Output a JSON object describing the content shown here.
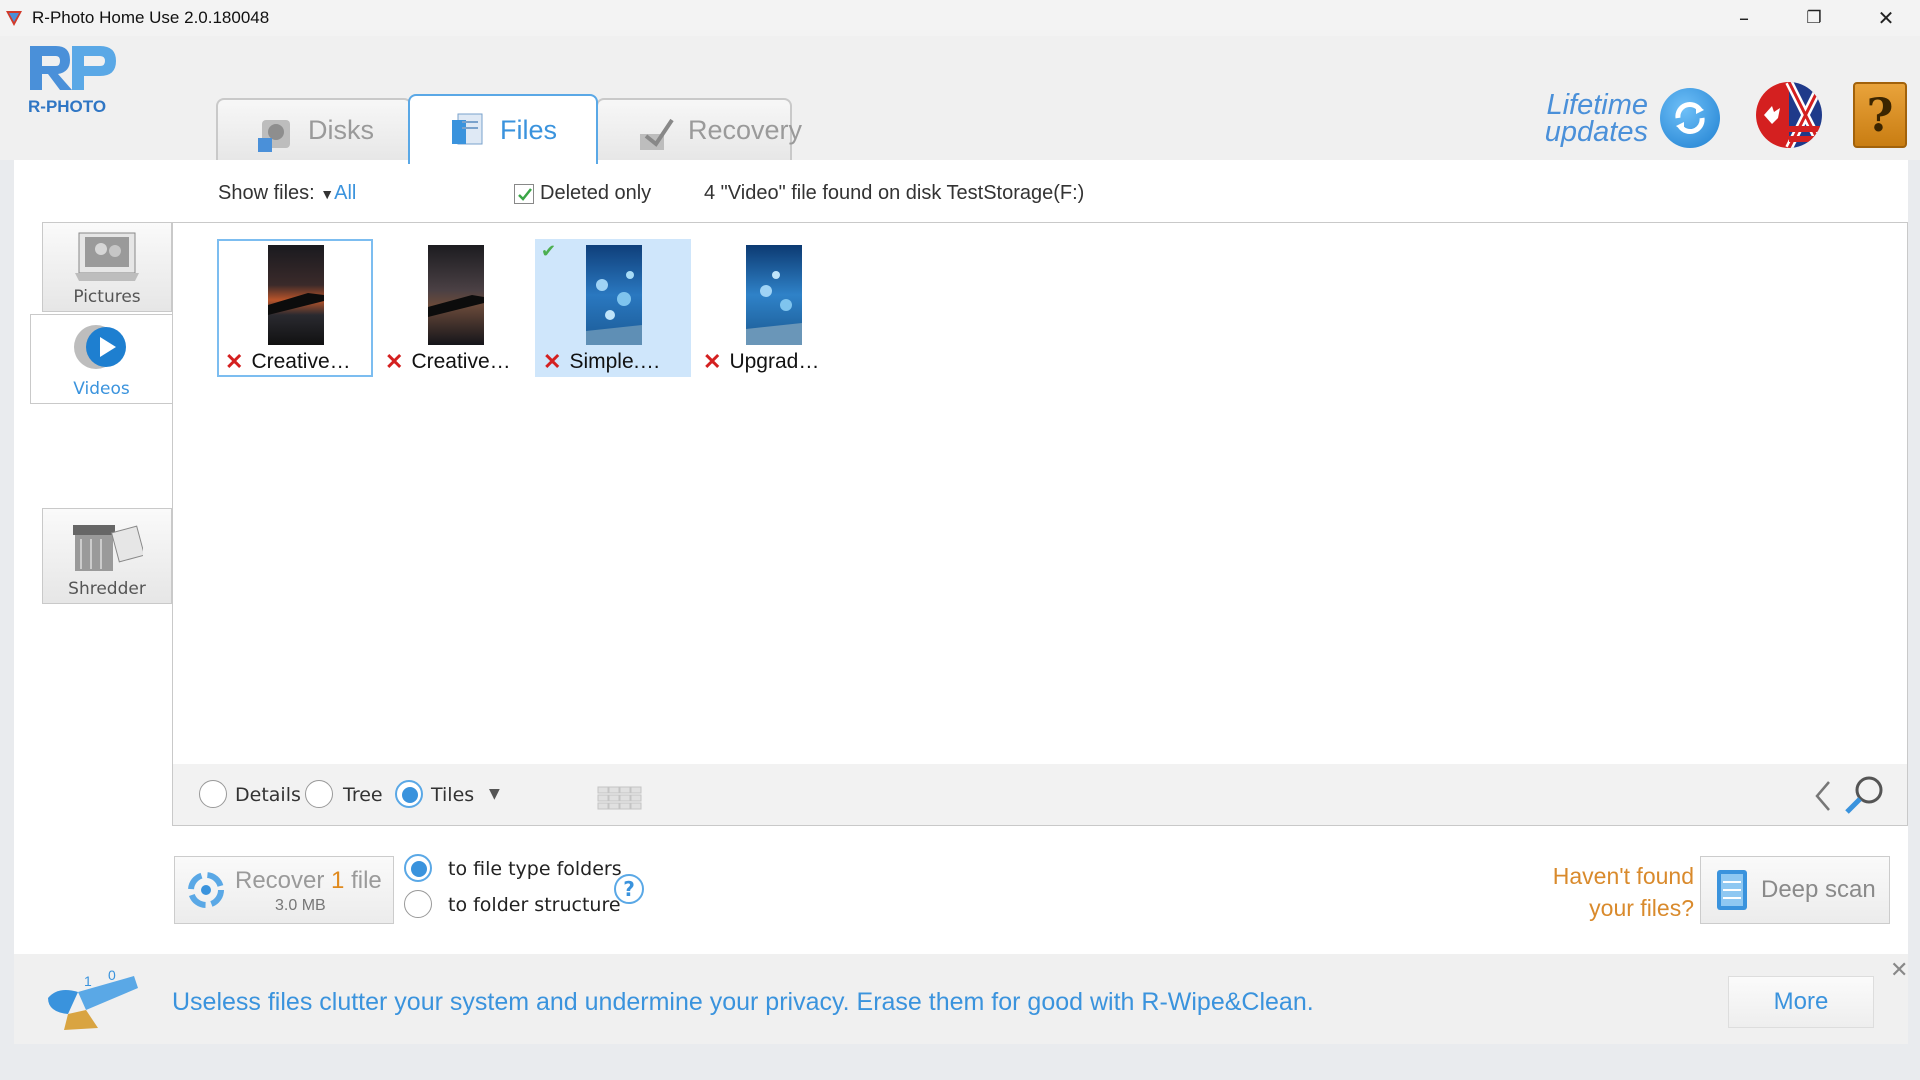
{
  "window": {
    "title": "R-Photo Home Use 2.0.180048",
    "minimize": "–",
    "restore": "❐",
    "close": "✕"
  },
  "header": {
    "logo_text": "R-PHOTO",
    "tabs": [
      {
        "label": "Disks",
        "icon": "disk-icon",
        "active": false
      },
      {
        "label": "Files",
        "icon": "files-icon",
        "active": true
      },
      {
        "label": "Recovery",
        "icon": "recovery-icon",
        "active": false
      }
    ],
    "lifetime_line1": "Lifetime",
    "lifetime_line2": "updates",
    "help": "?"
  },
  "filters": {
    "show_files_label": "Show files:",
    "show_files_value": "All",
    "deleted_only_label": "Deleted only",
    "deleted_only_checked": true,
    "found_text": "4 \"Video\" file found on disk TestStorage(F:)"
  },
  "sidebar": {
    "items": [
      {
        "label": "Pictures",
        "active": false
      },
      {
        "label": "Videos",
        "active": true
      },
      {
        "label": "Shredder",
        "active": false
      }
    ]
  },
  "files": [
    {
      "name": "Creative…",
      "deleted": true,
      "selected": false,
      "focused": true,
      "checked": false
    },
    {
      "name": "Creative…",
      "deleted": true,
      "selected": false,
      "focused": false,
      "checked": false
    },
    {
      "name": "Simple.…",
      "deleted": true,
      "selected": true,
      "focused": false,
      "checked": true
    },
    {
      "name": "Upgrad…",
      "deleted": true,
      "selected": false,
      "focused": false,
      "checked": false
    }
  ],
  "view": {
    "options": [
      "Details",
      "Tree",
      "Tiles"
    ],
    "selected": "Tiles"
  },
  "recover": {
    "label_pre": "Recover",
    "count": "1",
    "label_post": "file",
    "size": "3.0 MB",
    "dest_option1": "to file type folders",
    "dest_option2": "to folder structure",
    "dest_selected": 1,
    "help": "?"
  },
  "deepscan": {
    "question_line1": "Haven't found",
    "question_line2": "your files?",
    "button_label": "Deep scan"
  },
  "ad": {
    "text": "Useless files clutter your system and undermine your privacy. Erase them for good with R-Wipe&Clean.",
    "more_label": "More",
    "close": "✕"
  },
  "colors": {
    "accent": "#3a93dd",
    "orange": "#d98a2c",
    "deleted_red": "#d42020"
  }
}
